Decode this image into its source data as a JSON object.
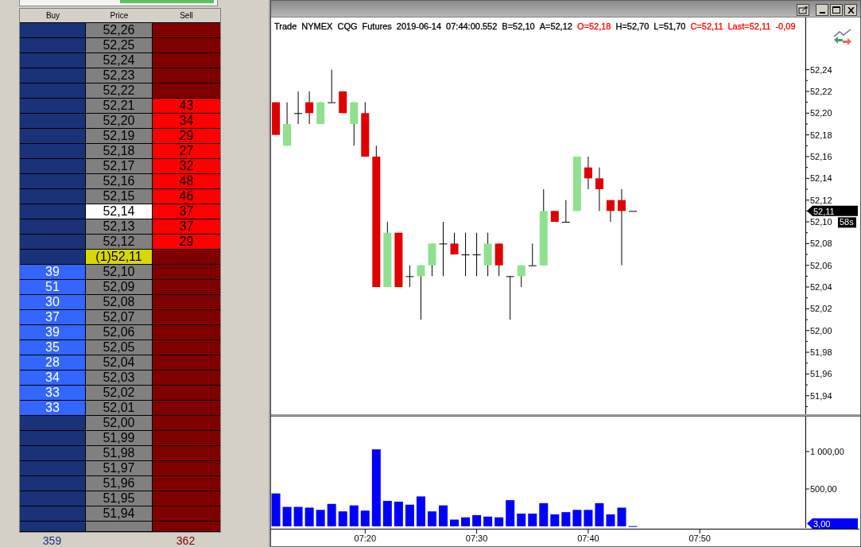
{
  "ladder": {
    "columns": [
      "Buy",
      "Price",
      "Sell"
    ],
    "rows": [
      {
        "price": "52,26",
        "highlighted": false,
        "last_trade": false
      },
      {
        "price": "52,25",
        "highlighted": false,
        "last_trade": false
      },
      {
        "price": "52,24",
        "highlighted": false,
        "last_trade": false
      },
      {
        "price": "52,23",
        "highlighted": false,
        "last_trade": false
      },
      {
        "price": "52,22",
        "highlighted": false,
        "last_trade": false
      },
      {
        "price": "52,21",
        "highlighted": false,
        "last_trade": false,
        "sell": "43"
      },
      {
        "price": "52,20",
        "highlighted": false,
        "last_trade": false,
        "sell": "34"
      },
      {
        "price": "52,19",
        "highlighted": false,
        "last_trade": false,
        "sell": "29"
      },
      {
        "price": "52,18",
        "highlighted": false,
        "last_trade": false,
        "sell": "27"
      },
      {
        "price": "52,17",
        "highlighted": false,
        "last_trade": false,
        "sell": "32"
      },
      {
        "price": "52,16",
        "highlighted": false,
        "last_trade": false,
        "sell": "48"
      },
      {
        "price": "52,15",
        "highlighted": false,
        "last_trade": false,
        "sell": "46"
      },
      {
        "price": "52,14",
        "highlighted": true,
        "last_trade": false,
        "sell": "37"
      },
      {
        "price": "52,13",
        "highlighted": false,
        "last_trade": false,
        "sell": "37"
      },
      {
        "price": "52,12",
        "highlighted": false,
        "last_trade": false,
        "sell": "29"
      },
      {
        "price": "(1)52,11",
        "highlighted": false,
        "last_trade": true
      },
      {
        "price": "52,10",
        "highlighted": false,
        "last_trade": false,
        "buy": "39"
      },
      {
        "price": "52,09",
        "highlighted": false,
        "last_trade": false,
        "buy": "51"
      },
      {
        "price": "52,08",
        "highlighted": false,
        "last_trade": false,
        "buy": "30"
      },
      {
        "price": "52,07",
        "highlighted": false,
        "last_trade": false,
        "buy": "37"
      },
      {
        "price": "52,06",
        "highlighted": false,
        "last_trade": false,
        "buy": "39"
      },
      {
        "price": "52,05",
        "highlighted": false,
        "last_trade": false,
        "buy": "35"
      },
      {
        "price": "52,04",
        "highlighted": false,
        "last_trade": false,
        "buy": "28"
      },
      {
        "price": "52,03",
        "highlighted": false,
        "last_trade": false,
        "buy": "34"
      },
      {
        "price": "52,02",
        "highlighted": false,
        "last_trade": false,
        "buy": "33"
      },
      {
        "price": "52,01",
        "highlighted": false,
        "last_trade": false,
        "buy": "33"
      },
      {
        "price": "52,00",
        "highlighted": false,
        "last_trade": false
      },
      {
        "price": "51,99",
        "highlighted": false,
        "last_trade": false
      },
      {
        "price": "51,98",
        "highlighted": false,
        "last_trade": false
      },
      {
        "price": "51,97",
        "highlighted": false,
        "last_trade": false
      },
      {
        "price": "51,96",
        "highlighted": false,
        "last_trade": false
      },
      {
        "price": "51,95",
        "highlighted": false,
        "last_trade": false
      },
      {
        "price": "51,94",
        "highlighted": false,
        "last_trade": false
      },
      {
        "highlighted": false,
        "last_trade": false
      }
    ],
    "totals": {
      "buy": "359",
      "sell": "362"
    }
  },
  "chart": {
    "header": [
      {
        "text": "Trade",
        "color": "#000000"
      },
      {
        "text": "NYMEX",
        "color": "#000000"
      },
      {
        "text": "CQG",
        "color": "#000000"
      },
      {
        "text": "Futures",
        "color": "#000000"
      },
      {
        "text": "2019-06-14",
        "color": "#000000"
      },
      {
        "text": "07:44:00.552",
        "color": "#000000"
      },
      {
        "text": "B=52,10",
        "color": "#000000"
      },
      {
        "text": "A=52,12",
        "color": "#000000"
      },
      {
        "text": "O=52,18",
        "color": "#ff0000"
      },
      {
        "text": "H=52,70",
        "color": "#000000"
      },
      {
        "text": "L=51,70",
        "color": "#000000"
      },
      {
        "text": "C=52,11",
        "color": "#ff0000"
      },
      {
        "text": "Last=52,11",
        "color": "#ff0000"
      },
      {
        "text": "-0,09",
        "color": "#ff0000"
      }
    ],
    "last_price": "52,11",
    "timer": "58s",
    "chart_data": {
      "type": "candlestick",
      "x": [
        432,
        433,
        434,
        435,
        436,
        437,
        438,
        439,
        440,
        441,
        442,
        443,
        444,
        445,
        446,
        447,
        448,
        449,
        450,
        451,
        452,
        453,
        454,
        455,
        456,
        457,
        458,
        459,
        460,
        461,
        462,
        463,
        464
      ],
      "ohlc": [
        [
          52.21,
          52.21,
          52.18,
          52.18
        ],
        [
          52.17,
          52.21,
          52.17,
          52.19
        ],
        [
          52.2,
          52.22,
          52.19,
          52.2
        ],
        [
          52.21,
          52.22,
          52.19,
          52.2
        ],
        [
          52.19,
          52.21,
          52.19,
          52.21
        ],
        [
          52.21,
          52.24,
          52.21,
          52.21
        ],
        [
          52.22,
          52.22,
          52.2,
          52.2
        ],
        [
          52.19,
          52.21,
          52.17,
          52.21
        ],
        [
          52.2,
          52.21,
          52.16,
          52.16
        ],
        [
          52.16,
          52.17,
          52.04,
          52.04
        ],
        [
          52.04,
          52.1,
          52.04,
          52.09
        ],
        [
          52.09,
          52.09,
          52.04,
          52.04
        ],
        [
          52.05,
          52.06,
          52.04,
          52.05
        ],
        [
          52.05,
          52.06,
          52.01,
          52.06
        ],
        [
          52.06,
          52.08,
          52.05,
          52.08
        ],
        [
          52.08,
          52.1,
          52.05,
          52.08
        ],
        [
          52.08,
          52.09,
          52.07,
          52.07
        ],
        [
          52.07,
          52.09,
          52.05,
          52.07
        ],
        [
          52.07,
          52.09,
          52.05,
          52.07
        ],
        [
          52.06,
          52.09,
          52.05,
          52.08
        ],
        [
          52.08,
          52.08,
          52.05,
          52.06
        ],
        [
          52.05,
          52.05,
          52.01,
          52.05
        ],
        [
          52.05,
          52.06,
          52.04,
          52.06
        ],
        [
          52.06,
          52.08,
          52.06,
          52.06
        ],
        [
          52.06,
          52.13,
          52.06,
          52.11
        ],
        [
          52.11,
          52.11,
          52.1,
          52.1
        ],
        [
          52.1,
          52.12,
          52.1,
          52.1
        ],
        [
          52.11,
          52.16,
          52.11,
          52.16
        ],
        [
          52.15,
          52.16,
          52.13,
          52.14
        ],
        [
          52.14,
          52.15,
          52.11,
          52.13
        ],
        [
          52.12,
          52.12,
          52.1,
          52.11
        ],
        [
          52.12,
          52.13,
          52.06,
          52.11
        ],
        [
          52.11,
          52.11,
          52.11,
          52.11
        ]
      ],
      "xlim": [
        431.57,
        484.31
      ],
      "ylim": [
        51.923,
        52.288
      ],
      "yticks": [
        {
          "value": 52.24,
          "label": "52,24"
        },
        {
          "value": 52.22,
          "label": "52,22"
        },
        {
          "value": 52.2,
          "label": "52,20"
        },
        {
          "value": 52.18,
          "label": "52,18"
        },
        {
          "value": 52.16,
          "label": "52,16"
        },
        {
          "value": 52.14,
          "label": "52,14"
        },
        {
          "value": 52.12,
          "label": "52,12"
        },
        {
          "value": 52.1,
          "label": "52,10"
        },
        {
          "value": 52.08,
          "label": "52,08"
        },
        {
          "value": 52.06,
          "label": "52,06"
        },
        {
          "value": 52.04,
          "label": "52,04"
        },
        {
          "value": 52.02,
          "label": "52,02"
        },
        {
          "value": 52.0,
          "label": "52,00"
        },
        {
          "value": 51.98,
          "label": "51,98"
        },
        {
          "value": 51.96,
          "label": "51,96"
        },
        {
          "value": 51.94,
          "label": "51,94"
        }
      ]
    }
  },
  "volume": {
    "last_value": "3,00",
    "chart_data": {
      "type": "bar",
      "x": [
        432,
        433,
        434,
        435,
        436,
        437,
        438,
        439,
        440,
        441,
        442,
        443,
        444,
        445,
        446,
        447,
        448,
        449,
        450,
        451,
        452,
        453,
        454,
        455,
        456,
        457,
        458,
        459,
        460,
        461,
        462,
        463,
        464
      ],
      "values": [
        440,
        260,
        260,
        250,
        220,
        300,
        200,
        280,
        210,
        1030,
        340,
        330,
        290,
        400,
        200,
        280,
        90,
        120,
        150,
        130,
        120,
        350,
        170,
        170,
        310,
        160,
        190,
        220,
        220,
        310,
        160,
        250,
        3
      ],
      "xlim": [
        431.57,
        484.31
      ],
      "ylim": [
        0,
        1468
      ],
      "yticks": [
        {
          "value": 500,
          "label": "500,00"
        },
        {
          "value": 1000,
          "label": "1 000,00"
        }
      ],
      "xticks": [
        {
          "value": 440,
          "label": "07:20"
        },
        {
          "value": 450,
          "label": "07:30"
        },
        {
          "value": 460,
          "label": "07:40"
        },
        {
          "value": 470,
          "label": "07:50"
        }
      ]
    }
  }
}
